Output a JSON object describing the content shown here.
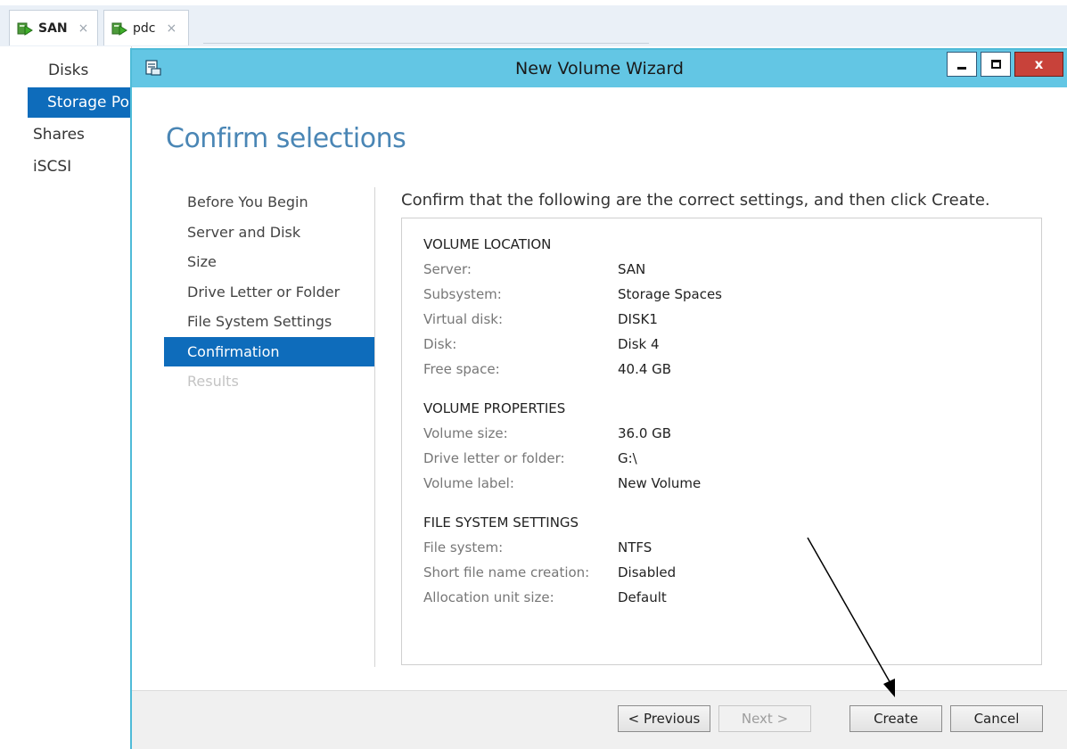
{
  "tabs": [
    {
      "label": "SAN",
      "close": "×",
      "icon": "server-play-icon"
    },
    {
      "label": "pdc",
      "close": "×",
      "icon": "server-play-icon"
    }
  ],
  "sidebar": {
    "items": [
      {
        "label": "Disks"
      },
      {
        "label": "Storage Po"
      },
      {
        "label": "Shares"
      },
      {
        "label": "iSCSI"
      }
    ]
  },
  "dialog": {
    "title": "New Volume Wizard",
    "close_label": "x",
    "heading": "Confirm selections",
    "steps": [
      {
        "label": "Before You Begin"
      },
      {
        "label": "Server and Disk"
      },
      {
        "label": "Size"
      },
      {
        "label": "Drive Letter or Folder"
      },
      {
        "label": "File System Settings"
      },
      {
        "label": "Confirmation"
      },
      {
        "label": "Results"
      }
    ],
    "instruction": "Confirm that the following are the correct settings, and then click Create.",
    "sections": [
      {
        "title": "VOLUME LOCATION",
        "rows": [
          {
            "key": "Server:",
            "value": "SAN"
          },
          {
            "key": "Subsystem:",
            "value": "Storage Spaces"
          },
          {
            "key": "Virtual disk:",
            "value": "DISK1"
          },
          {
            "key": "Disk:",
            "value": "Disk 4"
          },
          {
            "key": "Free space:",
            "value": "40.4 GB"
          }
        ]
      },
      {
        "title": "VOLUME PROPERTIES",
        "rows": [
          {
            "key": "Volume size:",
            "value": "36.0 GB"
          },
          {
            "key": "Drive letter or folder:",
            "value": "G:\\"
          },
          {
            "key": "Volume label:",
            "value": "New Volume"
          }
        ]
      },
      {
        "title": "FILE SYSTEM SETTINGS",
        "rows": [
          {
            "key": "File system:",
            "value": "NTFS"
          },
          {
            "key": "Short file name creation:",
            "value": "Disabled"
          },
          {
            "key": "Allocation unit size:",
            "value": "Default"
          }
        ]
      }
    ],
    "buttons": {
      "previous": "< Previous",
      "next": "Next >",
      "create": "Create",
      "cancel": "Cancel"
    }
  },
  "colors": {
    "titlebar": "#63c6e4",
    "selection": "#0e6cbb",
    "heading": "#4a86b5",
    "close_button": "#c8423a"
  }
}
